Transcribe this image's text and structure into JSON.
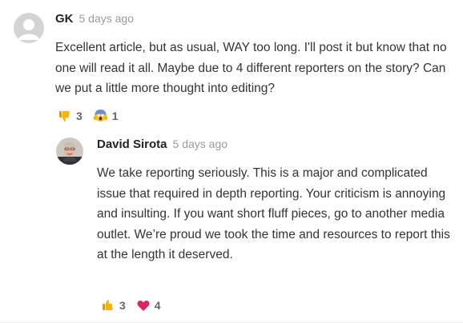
{
  "comments": [
    {
      "author": "GK",
      "time": "5 days ago",
      "body": "Excellent article, but as usual, WAY too long. I'll post it but know that no one will read it all. Maybe due to 4 different reporters on the story? Can we put a little more thought into editing?",
      "reactions": [
        {
          "icon": "thumbs-down-icon",
          "count": "3"
        },
        {
          "icon": "screaming-face-icon",
          "count": "1"
        }
      ]
    },
    {
      "author": "David Sirota",
      "time": "5 days ago",
      "body": "We take reporting seriously. This is a major and complicated issue that required in depth reporting. Your criticism is annoying and insulting. If you want short fluff pieces, go to another media outlet. We’re proud we took the time and resources to report this at the length it deserved.",
      "reactions": [
        {
          "icon": "thumbs-up-icon",
          "count": "3"
        },
        {
          "icon": "heart-icon",
          "count": "4"
        }
      ]
    }
  ],
  "colors": {
    "reaction_yellow": "#f4b400",
    "heart_red": "#e0245e",
    "muted": "#9a9a9a"
  }
}
